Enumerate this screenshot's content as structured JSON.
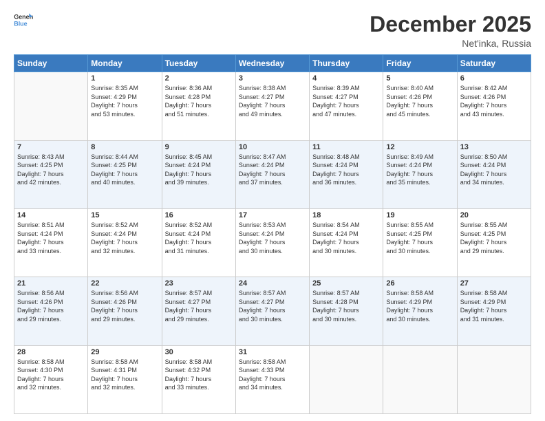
{
  "header": {
    "logo_general": "General",
    "logo_blue": "Blue",
    "title": "December 2025",
    "subtitle": "Net'inka, Russia"
  },
  "calendar": {
    "days_of_week": [
      "Sunday",
      "Monday",
      "Tuesday",
      "Wednesday",
      "Thursday",
      "Friday",
      "Saturday"
    ],
    "weeks": [
      [
        {
          "day": "",
          "info": ""
        },
        {
          "day": "1",
          "info": "Sunrise: 8:35 AM\nSunset: 4:29 PM\nDaylight: 7 hours\nand 53 minutes."
        },
        {
          "day": "2",
          "info": "Sunrise: 8:36 AM\nSunset: 4:28 PM\nDaylight: 7 hours\nand 51 minutes."
        },
        {
          "day": "3",
          "info": "Sunrise: 8:38 AM\nSunset: 4:27 PM\nDaylight: 7 hours\nand 49 minutes."
        },
        {
          "day": "4",
          "info": "Sunrise: 8:39 AM\nSunset: 4:27 PM\nDaylight: 7 hours\nand 47 minutes."
        },
        {
          "day": "5",
          "info": "Sunrise: 8:40 AM\nSunset: 4:26 PM\nDaylight: 7 hours\nand 45 minutes."
        },
        {
          "day": "6",
          "info": "Sunrise: 8:42 AM\nSunset: 4:26 PM\nDaylight: 7 hours\nand 43 minutes."
        }
      ],
      [
        {
          "day": "7",
          "info": "Sunrise: 8:43 AM\nSunset: 4:25 PM\nDaylight: 7 hours\nand 42 minutes."
        },
        {
          "day": "8",
          "info": "Sunrise: 8:44 AM\nSunset: 4:25 PM\nDaylight: 7 hours\nand 40 minutes."
        },
        {
          "day": "9",
          "info": "Sunrise: 8:45 AM\nSunset: 4:24 PM\nDaylight: 7 hours\nand 39 minutes."
        },
        {
          "day": "10",
          "info": "Sunrise: 8:47 AM\nSunset: 4:24 PM\nDaylight: 7 hours\nand 37 minutes."
        },
        {
          "day": "11",
          "info": "Sunrise: 8:48 AM\nSunset: 4:24 PM\nDaylight: 7 hours\nand 36 minutes."
        },
        {
          "day": "12",
          "info": "Sunrise: 8:49 AM\nSunset: 4:24 PM\nDaylight: 7 hours\nand 35 minutes."
        },
        {
          "day": "13",
          "info": "Sunrise: 8:50 AM\nSunset: 4:24 PM\nDaylight: 7 hours\nand 34 minutes."
        }
      ],
      [
        {
          "day": "14",
          "info": "Sunrise: 8:51 AM\nSunset: 4:24 PM\nDaylight: 7 hours\nand 33 minutes."
        },
        {
          "day": "15",
          "info": "Sunrise: 8:52 AM\nSunset: 4:24 PM\nDaylight: 7 hours\nand 32 minutes."
        },
        {
          "day": "16",
          "info": "Sunrise: 8:52 AM\nSunset: 4:24 PM\nDaylight: 7 hours\nand 31 minutes."
        },
        {
          "day": "17",
          "info": "Sunrise: 8:53 AM\nSunset: 4:24 PM\nDaylight: 7 hours\nand 30 minutes."
        },
        {
          "day": "18",
          "info": "Sunrise: 8:54 AM\nSunset: 4:24 PM\nDaylight: 7 hours\nand 30 minutes."
        },
        {
          "day": "19",
          "info": "Sunrise: 8:55 AM\nSunset: 4:25 PM\nDaylight: 7 hours\nand 30 minutes."
        },
        {
          "day": "20",
          "info": "Sunrise: 8:55 AM\nSunset: 4:25 PM\nDaylight: 7 hours\nand 29 minutes."
        }
      ],
      [
        {
          "day": "21",
          "info": "Sunrise: 8:56 AM\nSunset: 4:26 PM\nDaylight: 7 hours\nand 29 minutes."
        },
        {
          "day": "22",
          "info": "Sunrise: 8:56 AM\nSunset: 4:26 PM\nDaylight: 7 hours\nand 29 minutes."
        },
        {
          "day": "23",
          "info": "Sunrise: 8:57 AM\nSunset: 4:27 PM\nDaylight: 7 hours\nand 29 minutes."
        },
        {
          "day": "24",
          "info": "Sunrise: 8:57 AM\nSunset: 4:27 PM\nDaylight: 7 hours\nand 30 minutes."
        },
        {
          "day": "25",
          "info": "Sunrise: 8:57 AM\nSunset: 4:28 PM\nDaylight: 7 hours\nand 30 minutes."
        },
        {
          "day": "26",
          "info": "Sunrise: 8:58 AM\nSunset: 4:29 PM\nDaylight: 7 hours\nand 30 minutes."
        },
        {
          "day": "27",
          "info": "Sunrise: 8:58 AM\nSunset: 4:29 PM\nDaylight: 7 hours\nand 31 minutes."
        }
      ],
      [
        {
          "day": "28",
          "info": "Sunrise: 8:58 AM\nSunset: 4:30 PM\nDaylight: 7 hours\nand 32 minutes."
        },
        {
          "day": "29",
          "info": "Sunrise: 8:58 AM\nSunset: 4:31 PM\nDaylight: 7 hours\nand 32 minutes."
        },
        {
          "day": "30",
          "info": "Sunrise: 8:58 AM\nSunset: 4:32 PM\nDaylight: 7 hours\nand 33 minutes."
        },
        {
          "day": "31",
          "info": "Sunrise: 8:58 AM\nSunset: 4:33 PM\nDaylight: 7 hours\nand 34 minutes."
        },
        {
          "day": "",
          "info": ""
        },
        {
          "day": "",
          "info": ""
        },
        {
          "day": "",
          "info": ""
        }
      ]
    ]
  }
}
